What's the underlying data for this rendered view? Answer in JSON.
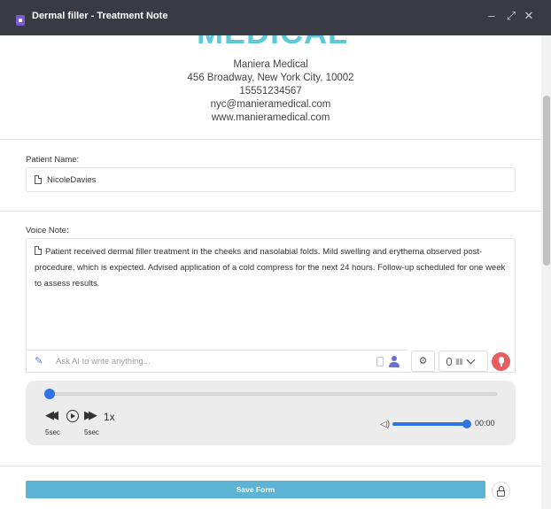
{
  "window": {
    "title": "Dermal filler - Treatment Note",
    "minimize": "–",
    "maximize": "⤢",
    "close": "✕"
  },
  "clinic": {
    "logo_text": "MEDICAL",
    "name": "Maniera Medical",
    "address": "456 Broadway, New York City, 10002",
    "phone": "15551234567",
    "email": "nyc@manieramedical.com",
    "website": "www.manieramedical.com"
  },
  "patient": {
    "label": "Patient Name:",
    "value": "NicoleDavies"
  },
  "voice_note": {
    "label": "Voice Note:",
    "text": "Patient received dermal filler treatment in the cheeks and nasolabial folds. Mild swelling and erythema observed post-procedure, which is expected. Advised application of a cold compress for the next 24 hours. Follow-up scheduled for one week to assess results."
  },
  "ai": {
    "placeholder": "Ask AI to write anything..."
  },
  "player": {
    "speed": "1x",
    "rewind_label": "5sec",
    "forward_label": "5sec",
    "time": "00:00",
    "progress": 0,
    "volume": 1
  },
  "actions": {
    "save_label": "Save Form"
  },
  "colors": {
    "titlebar": "#3a3a45",
    "accent_blue": "#2f74e0",
    "save_button": "#5cb3d4",
    "record_button": "#e85d62",
    "logo": "#5cc8d8"
  },
  "icons": [
    "app-icon",
    "minimize-icon",
    "maximize-icon",
    "close-icon",
    "document-icon",
    "magic-wand-icon",
    "clipboard-icon",
    "user-icon",
    "gear-icon",
    "microphone-icon",
    "chevron-down-icon",
    "record-icon",
    "rewind-icon",
    "play-icon",
    "fast-forward-icon",
    "volume-icon",
    "lock-icon"
  ]
}
